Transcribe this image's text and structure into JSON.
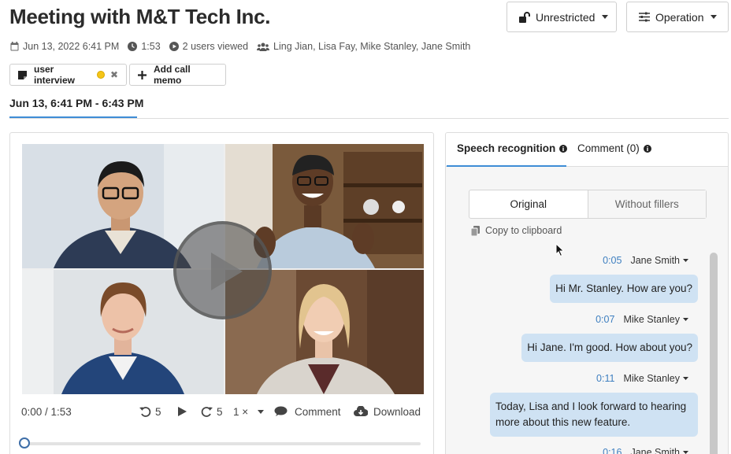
{
  "title": "Meeting with M&T Tech Inc.",
  "header_buttons": {
    "access": "Unrestricted",
    "operation": "Operation"
  },
  "meta": {
    "date": "Jun 13, 2022 6:41 PM",
    "duration": "1:53",
    "views": "2 users viewed",
    "participants": "Ling Jian, Lisa Fay, Mike Stanley, Jane Smith"
  },
  "tags": {
    "tag_label": "user interview",
    "memo_label": "Add call memo"
  },
  "date_tab": "Jun 13, 6:41 PM - 6:43 PM",
  "player": {
    "time": "0:00 / 1:53",
    "rewind": "5",
    "forward": "5",
    "speed": "1 ×",
    "comment": "Comment",
    "download": "Download",
    "progress": 0
  },
  "right_panel": {
    "tabs": {
      "speech": "Speech recognition",
      "comment": "Comment (0)"
    },
    "segments": {
      "original": "Original",
      "without_fillers": "Without fillers"
    },
    "copy": "Copy to clipboard",
    "messages": [
      {
        "time": "0:05",
        "speaker": "Jane Smith",
        "text": "Hi Mr. Stanley. How are you?"
      },
      {
        "time": "0:07",
        "speaker": "Mike Stanley",
        "text": "Hi Jane. I'm good. How about you?"
      },
      {
        "time": "0:11",
        "speaker": "Mike Stanley",
        "text": "Today, Lisa and I look forward to hearing more about this new feature."
      },
      {
        "time": "0:16",
        "speaker": "Jane Smith",
        "text": ""
      }
    ]
  },
  "colors": {
    "accent": "#3e8dd6",
    "bubble": "#cfe2f3",
    "timestamp": "#3e7fc0"
  }
}
